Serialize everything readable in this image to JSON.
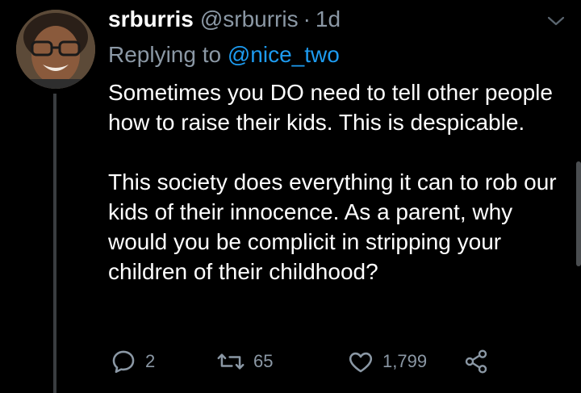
{
  "tweet": {
    "author": {
      "display_name": "srburris",
      "handle": "@srburris",
      "separator": "·",
      "time": "1d"
    },
    "replying_prefix": "Replying to",
    "replying_to": "@nice_two",
    "body": {
      "paragraph_1": "Sometimes you DO need to tell other people how to raise their kids. This is despicable.",
      "paragraph_2": "This society does everything it can to rob our kids of their innocence. As a parent, why would you be complicit in stripping your children of their childhood?"
    },
    "actions": {
      "reply": {
        "icon": "reply-icon",
        "count": "2"
      },
      "retweet": {
        "icon": "retweet-icon",
        "count": "65"
      },
      "like": {
        "icon": "heart-icon",
        "count": "1,799"
      },
      "share": {
        "icon": "share-icon"
      }
    }
  },
  "colors": {
    "background": "#000000",
    "text": "#ffffff",
    "muted": "#8b98a5",
    "link": "#1d9bf0",
    "thread_line": "#3a3d40"
  }
}
